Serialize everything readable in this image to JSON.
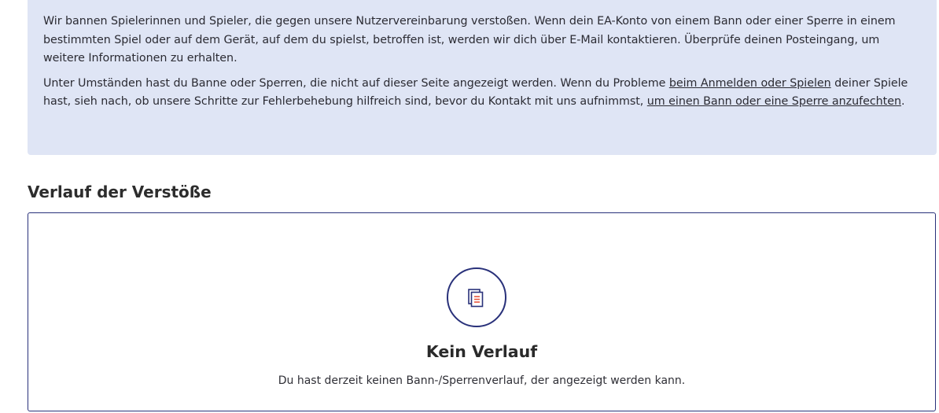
{
  "info": {
    "paragraph1": "Wir bannen Spielerinnen und Spieler, die gegen unsere Nutzervereinbarung verstoßen. Wenn dein EA-Konto von einem Bann oder einer Sperre in einem bestimmten Spiel oder auf dem Gerät, auf dem du spielst, betroffen ist, werden wir dich über E-Mail kontaktieren. Überprüfe deinen Posteingang, um weitere Informationen zu erhalten.",
    "paragraph2_part1": "Unter Umständen hast du Banne oder Sperren, die nicht auf dieser Seite angezeigt werden. Wenn du Probleme ",
    "link_login": "beim Anmelden oder Spielen",
    "paragraph2_part2": " deiner Spiele hast, sieh nach, ob unsere Schritte zur Fehlerbehebung hilfreich sind, bevor du Kontakt mit uns aufnimmst, ",
    "link_appeal": "um einen Bann oder eine Sperre anzufechten",
    "paragraph2_part3": "."
  },
  "history": {
    "heading": "Verlauf der Verstöße",
    "empty_icon": "documents-icon",
    "empty_title": "Kein Verlauf",
    "empty_text": "Du hast derzeit keinen Bann-/Sperrenverlauf, der angezeigt werden kann."
  },
  "colors": {
    "panel_bg": "#dfe5f5",
    "border_accent": "#29317a",
    "icon_accent": "#e8553d"
  }
}
